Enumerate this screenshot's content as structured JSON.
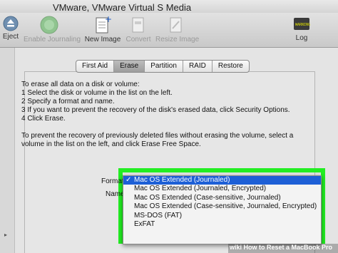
{
  "window": {
    "title": "VMware, VMware Virtual S Media"
  },
  "toolbar": {
    "items": [
      {
        "label": "Eject",
        "icon": "eject-icon",
        "enabled": true
      },
      {
        "label": "Enable Journaling",
        "icon": "journaling-icon",
        "enabled": false
      },
      {
        "label": "New Image",
        "icon": "new-image-icon",
        "enabled": true
      },
      {
        "label": "Convert",
        "icon": "convert-icon",
        "enabled": false
      },
      {
        "label": "Resize Image",
        "icon": "resize-image-icon",
        "enabled": false
      },
      {
        "label": "Log",
        "icon": "log-icon",
        "enabled": true
      }
    ],
    "log_badge": "WARNING"
  },
  "tabs": [
    {
      "label": "First Aid",
      "active": false
    },
    {
      "label": "Erase",
      "active": true
    },
    {
      "label": "Partition",
      "active": false
    },
    {
      "label": "RAID",
      "active": false
    },
    {
      "label": "Restore",
      "active": false
    }
  ],
  "instructions": {
    "lines": [
      "To erase all data on a disk or volume:",
      "1  Select the disk or volume in the list on the left.",
      "2  Specify a format and name.",
      "3  If you want to prevent the recovery of the disk's erased data, click Security Options.",
      "4  Click Erase."
    ],
    "free_space_lines": [
      "To prevent the recovery of previously deleted files without erasing the volume, select a",
      "volume in the list on the left, and click Erase Free Space."
    ]
  },
  "form": {
    "format_label": "Format",
    "name_label": "Name"
  },
  "format_menu": {
    "options": [
      "Mac OS Extended (Journaled)",
      "Mac OS Extended (Journaled, Encrypted)",
      "Mac OS Extended (Case-sensitive, Journaled)",
      "Mac OS Extended (Case-sensitive, Journaled, Encrypted)",
      "MS-DOS (FAT)",
      "ExFAT"
    ],
    "selected_index": 0,
    "check_mark": "✓"
  },
  "highlight_color": "#22ee22",
  "watermark": {
    "prefix": "wiki",
    "text": "How to Reset a MacBook Pro"
  }
}
